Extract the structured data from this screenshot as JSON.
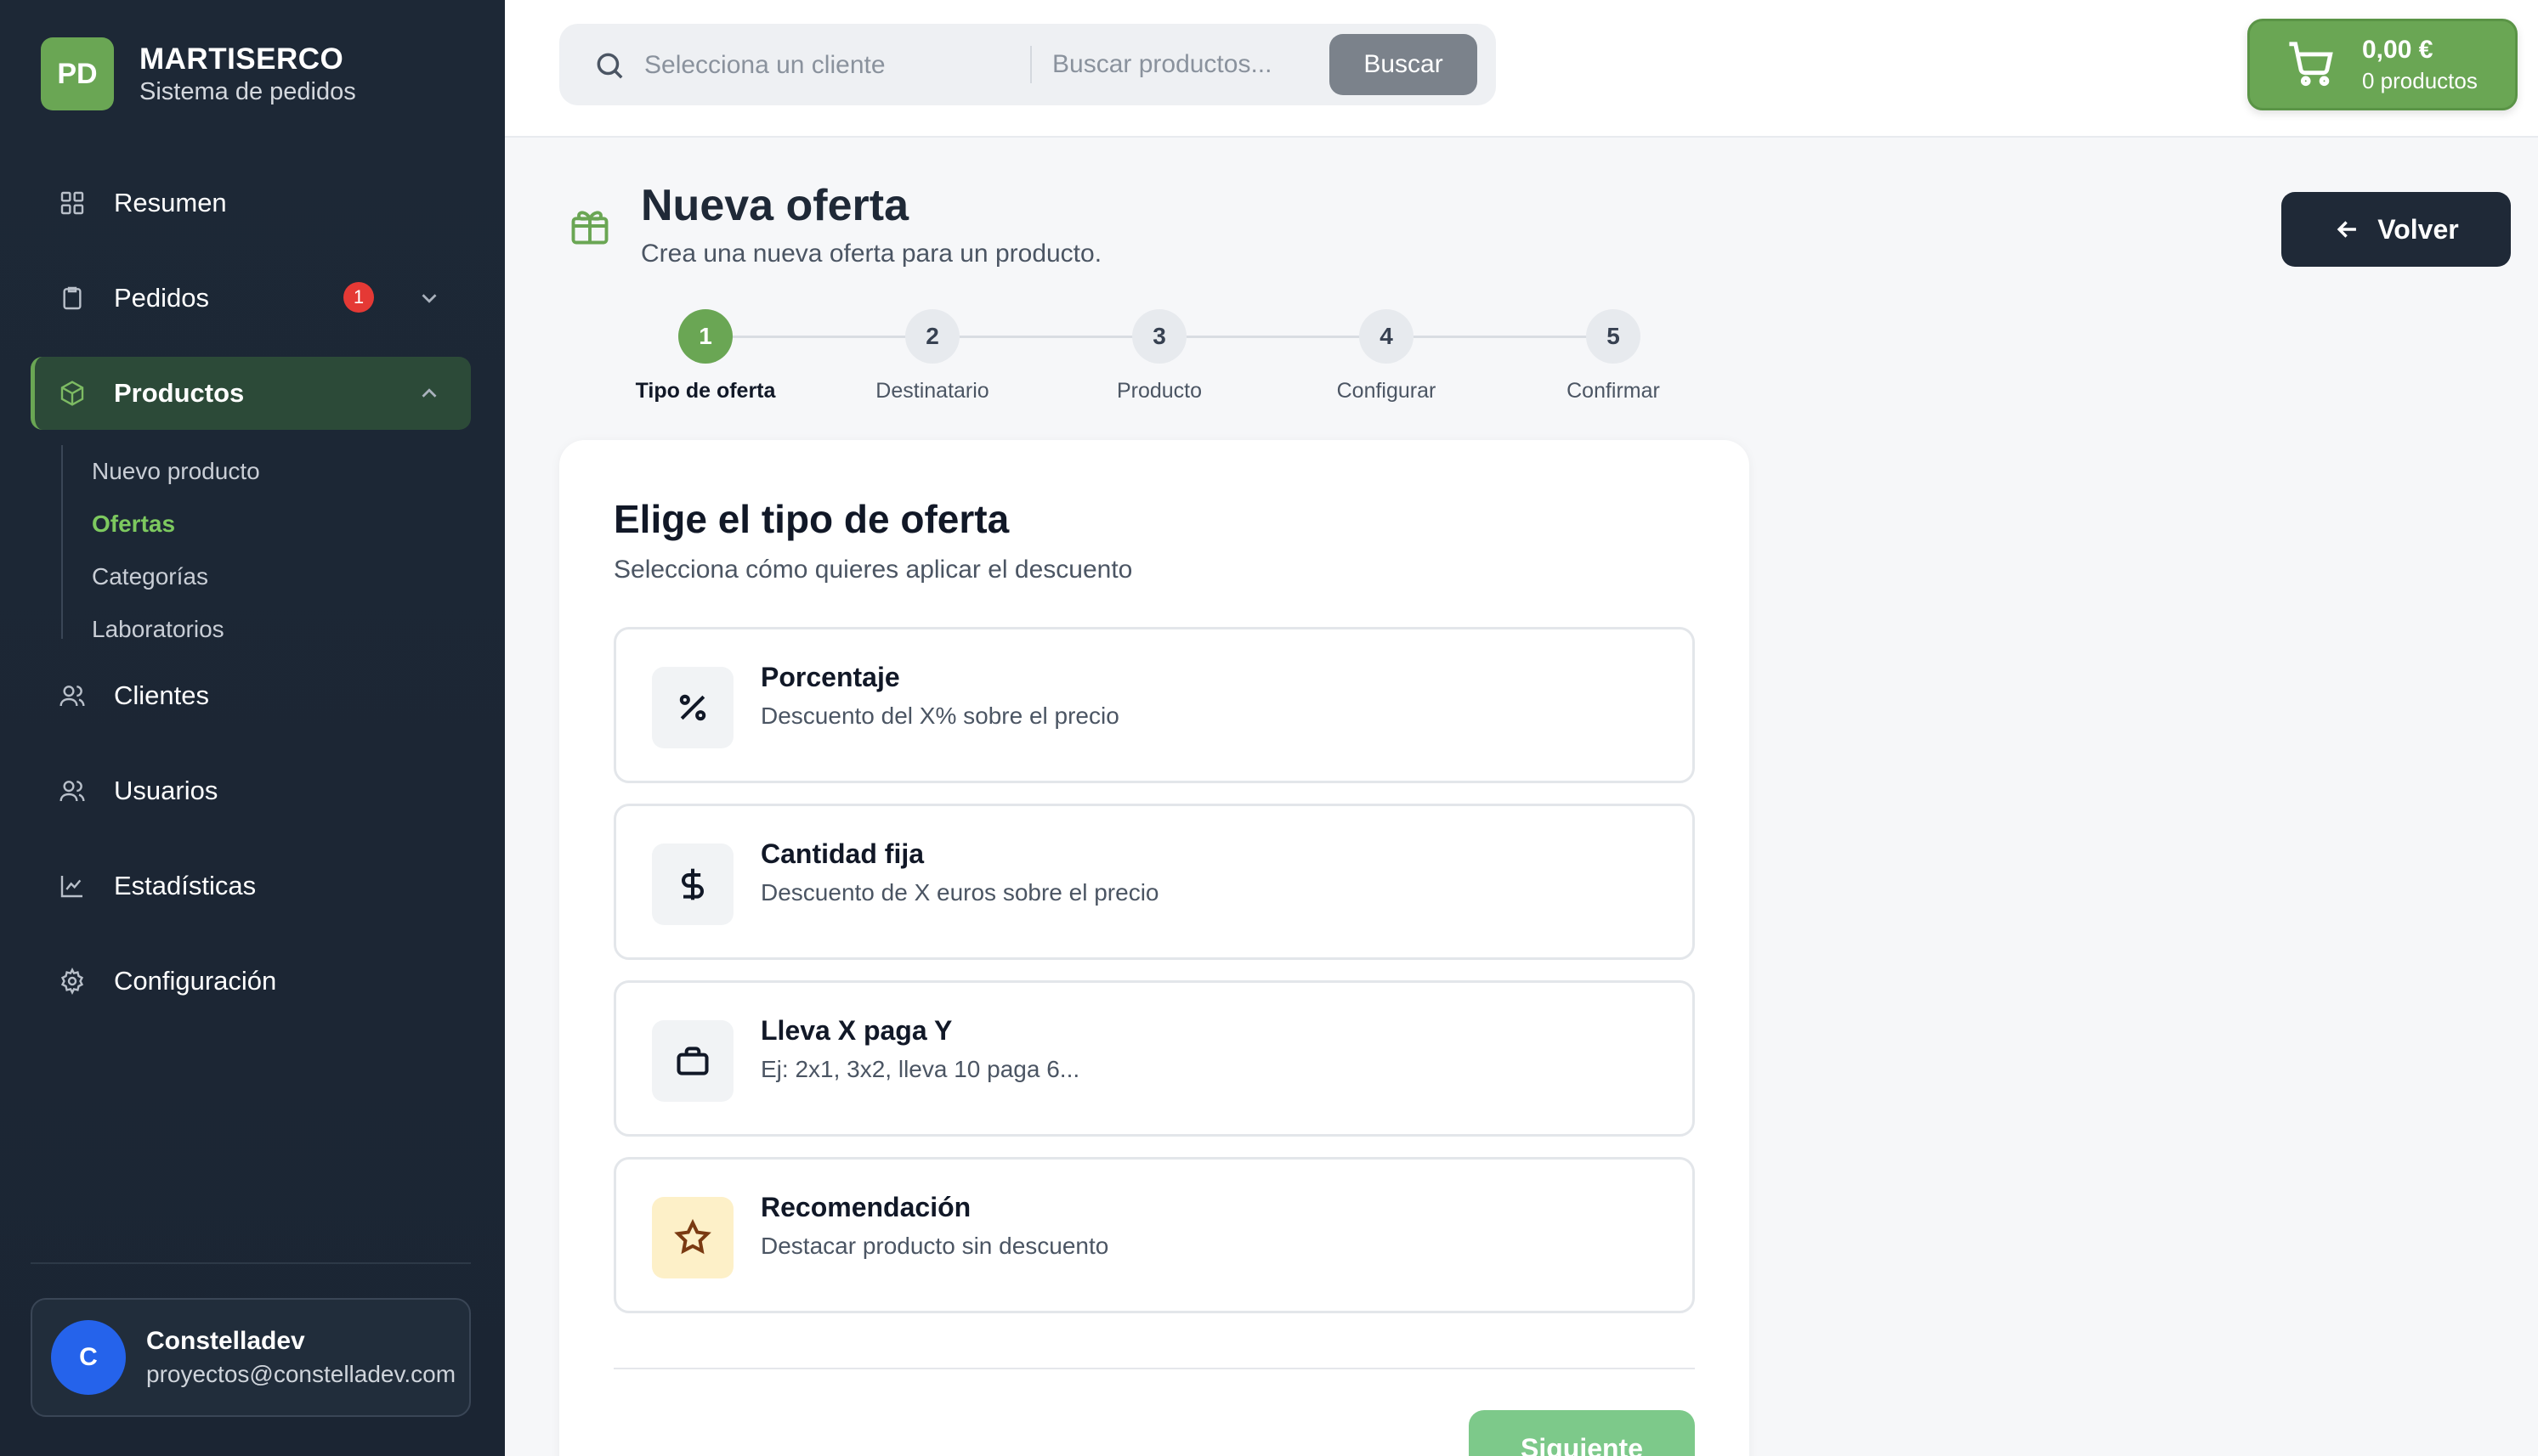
{
  "brand": {
    "logo": "PD",
    "name": "MARTISERCO",
    "subtitle": "Sistema de pedidos"
  },
  "sidebar": {
    "items": [
      {
        "label": "Resumen",
        "icon": "grid-icon"
      },
      {
        "label": "Pedidos",
        "icon": "clipboard-icon",
        "badge": "1"
      },
      {
        "label": "Productos",
        "icon": "box-icon",
        "active": true
      },
      {
        "label": "Clientes",
        "icon": "users-icon"
      },
      {
        "label": "Usuarios",
        "icon": "users-icon"
      },
      {
        "label": "Estadísticas",
        "icon": "chart-icon"
      },
      {
        "label": "Configuración",
        "icon": "gear-icon"
      }
    ],
    "subitems": [
      "Nuevo producto",
      "Ofertas",
      "Categorías",
      "Laboratorios"
    ],
    "active_subitem": "Ofertas"
  },
  "user": {
    "initial": "C",
    "name": "Constelladev",
    "email": "proyectos@constelladev.com"
  },
  "search": {
    "client_placeholder": "Selecciona un cliente",
    "product_placeholder": "Buscar productos...",
    "button": "Buscar"
  },
  "cart": {
    "total": "0,00 €",
    "count": "0 productos"
  },
  "page": {
    "title": "Nueva oferta",
    "subtitle": "Crea una nueva oferta para un producto.",
    "back": "Volver"
  },
  "steps": [
    {
      "num": "1",
      "label": "Tipo de oferta",
      "active": true
    },
    {
      "num": "2",
      "label": "Destinatario"
    },
    {
      "num": "3",
      "label": "Producto"
    },
    {
      "num": "4",
      "label": "Configurar"
    },
    {
      "num": "5",
      "label": "Confirmar"
    }
  ],
  "card": {
    "title": "Elige el tipo de oferta",
    "subtitle": "Selecciona cómo quieres aplicar el descuento",
    "options": [
      {
        "title": "Porcentaje",
        "desc": "Descuento del X% sobre el precio",
        "icon": "percent-icon"
      },
      {
        "title": "Cantidad fija",
        "desc": "Descuento de X euros sobre el precio",
        "icon": "dollar-icon"
      },
      {
        "title": "Lleva X paga Y",
        "desc": "Ej: 2x1, 3x2, lleva 10 paga 6...",
        "icon": "bag-icon"
      },
      {
        "title": "Recomendación",
        "desc": "Destacar producto sin descuento",
        "icon": "star-icon"
      }
    ],
    "next": "Siguiente"
  },
  "colors": {
    "accent": "#6aa654",
    "sidebar": "#1d2836",
    "badge": "#e53935",
    "dark_button": "#1f2937"
  }
}
